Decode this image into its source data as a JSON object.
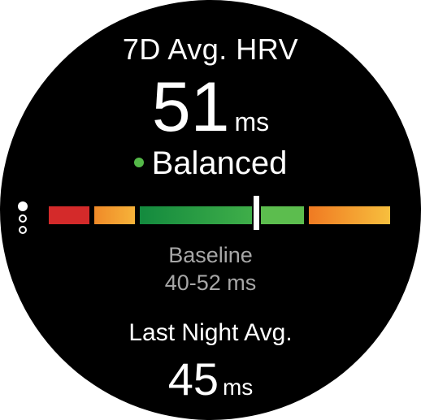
{
  "hrv": {
    "title": "7D Avg. HRV",
    "value": "51",
    "unit": "ms",
    "status": "Balanced",
    "status_color": "#54b848"
  },
  "baseline": {
    "label": "Baseline",
    "range": "40-52 ms"
  },
  "last_night": {
    "title": "Last Night Avg.",
    "value": "45",
    "unit": "ms"
  },
  "gauge": {
    "marker_position": 0.605,
    "segments": [
      {
        "name": "low",
        "color": "#d92b2b"
      },
      {
        "name": "unbalanced-low",
        "color": "#f5a623"
      },
      {
        "name": "balanced",
        "color": "#1f9a48"
      },
      {
        "name": "balanced-high",
        "color": "#5cbd4e"
      },
      {
        "name": "unbalanced-high",
        "color": "#f58a24"
      }
    ]
  },
  "page_indicator": {
    "current": 1,
    "total": 3
  }
}
